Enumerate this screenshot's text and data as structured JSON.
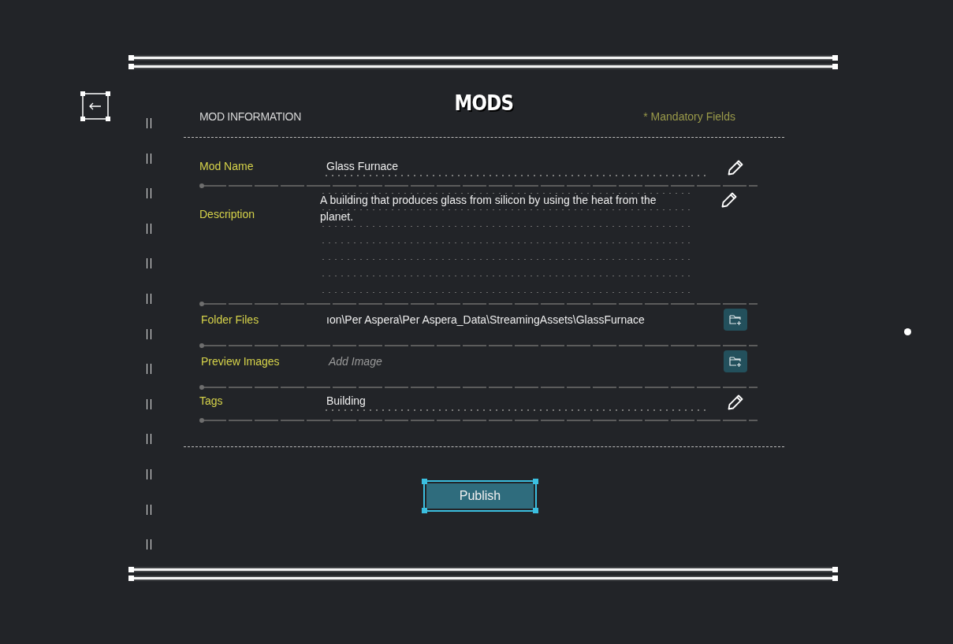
{
  "title": "MODS",
  "section": {
    "heading": "MOD INFORMATION",
    "note": "* Mandatory Fields"
  },
  "fields": [
    {
      "label": "Mod Name",
      "kind": "text",
      "value": "Glass Furnace",
      "action": {
        "kind": "edit"
      }
    },
    {
      "label": "Description",
      "kind": "multiline",
      "value": "A building that produces glass from silicon by using the heat from the planet.",
      "action": {
        "kind": "edit"
      }
    },
    {
      "label": "Folder Files",
      "kind": "path",
      "value": "ıon\\Per Aspera\\Per Aspera_Data\\StreamingAssets\\GlassFurnace",
      "action": {
        "kind": "add-folder"
      }
    },
    {
      "label": "Preview Images",
      "kind": "path",
      "placeholder": "Add Image",
      "action": {
        "kind": "add-folder"
      }
    },
    {
      "label": "Tags",
      "kind": "text",
      "value": "Building",
      "action": {
        "kind": "edit"
      }
    }
  ],
  "publish": {
    "label": "Publish",
    "focused": true
  }
}
